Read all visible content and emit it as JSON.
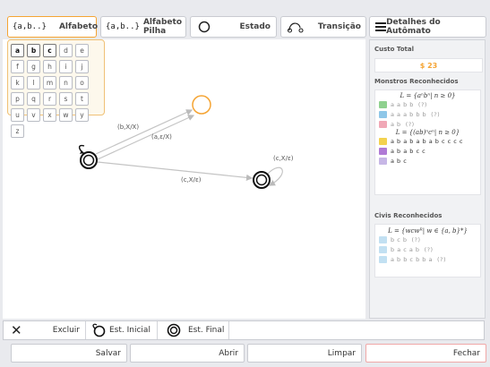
{
  "tabs": {
    "alphabet_icon": "{a,b..}",
    "alphabet_label": "Alfabeto",
    "stack_alphabet_icon": "{a,b..}",
    "stack_alphabet_label": "Alfabeto Pilha",
    "state_label": "Estado",
    "transition_label": "Transição",
    "details_label": "Detalhes do Autômato"
  },
  "alphabet": {
    "keys": [
      "a",
      "b",
      "c",
      "d",
      "e",
      "f",
      "g",
      "h",
      "i",
      "j",
      "k",
      "l",
      "m",
      "n",
      "o",
      "p",
      "q",
      "r",
      "s",
      "t",
      "u",
      "v",
      "x",
      "w",
      "y",
      "z"
    ],
    "selected": [
      "a",
      "b",
      "c"
    ]
  },
  "transitions": {
    "t1": "(b,X/X)",
    "t2": "(a,ε/X)",
    "t3": "(c,X/ε)",
    "t4": "(c,X/ε)"
  },
  "panel": {
    "cost_title": "Custo Total",
    "cost_value": "$ 23",
    "monsters_title": "Monstros Reconhecidos",
    "monsters_lang1": "L = {aⁿbⁿ| n ≥ 0}",
    "monsters_group1": [
      {
        "word": "a a b b",
        "status": "(?)"
      },
      {
        "word": "a a a b b b",
        "status": "(?)"
      },
      {
        "word": "a b",
        "status": "(?)"
      }
    ],
    "monsters_lang2": "L = {(ab)ⁿcⁿ| n ≥ 0}",
    "monsters_group2": [
      {
        "word": "a b a b a b a b c c c c",
        "status": ""
      },
      {
        "word": "a b a b c c",
        "status": ""
      },
      {
        "word": "a b c",
        "status": ""
      }
    ],
    "civis_title": "Civis Reconhecidos",
    "civis_lang": "L = {wcwᴿ| w ∈ {a, b}*}",
    "civis": [
      {
        "word": "b c b",
        "status": "(?)"
      },
      {
        "word": "b a c a b",
        "status": "(?)"
      },
      {
        "word": "a b b c b b a",
        "status": "(?)"
      }
    ],
    "colors": {
      "green": "#8fd18f",
      "blue": "#8fc7e8",
      "pink": "#f0a8b6",
      "yellow": "#f3d24f",
      "purple": "#b07ad6",
      "lavender": "#c7b7e6"
    }
  },
  "tools": {
    "delete_label": "Excluir",
    "initial_label": "Est. Inicial",
    "final_label": "Est. Final"
  },
  "buttons": {
    "save": "Salvar",
    "open": "Abrir",
    "clear": "Limpar",
    "close": "Fechar"
  }
}
